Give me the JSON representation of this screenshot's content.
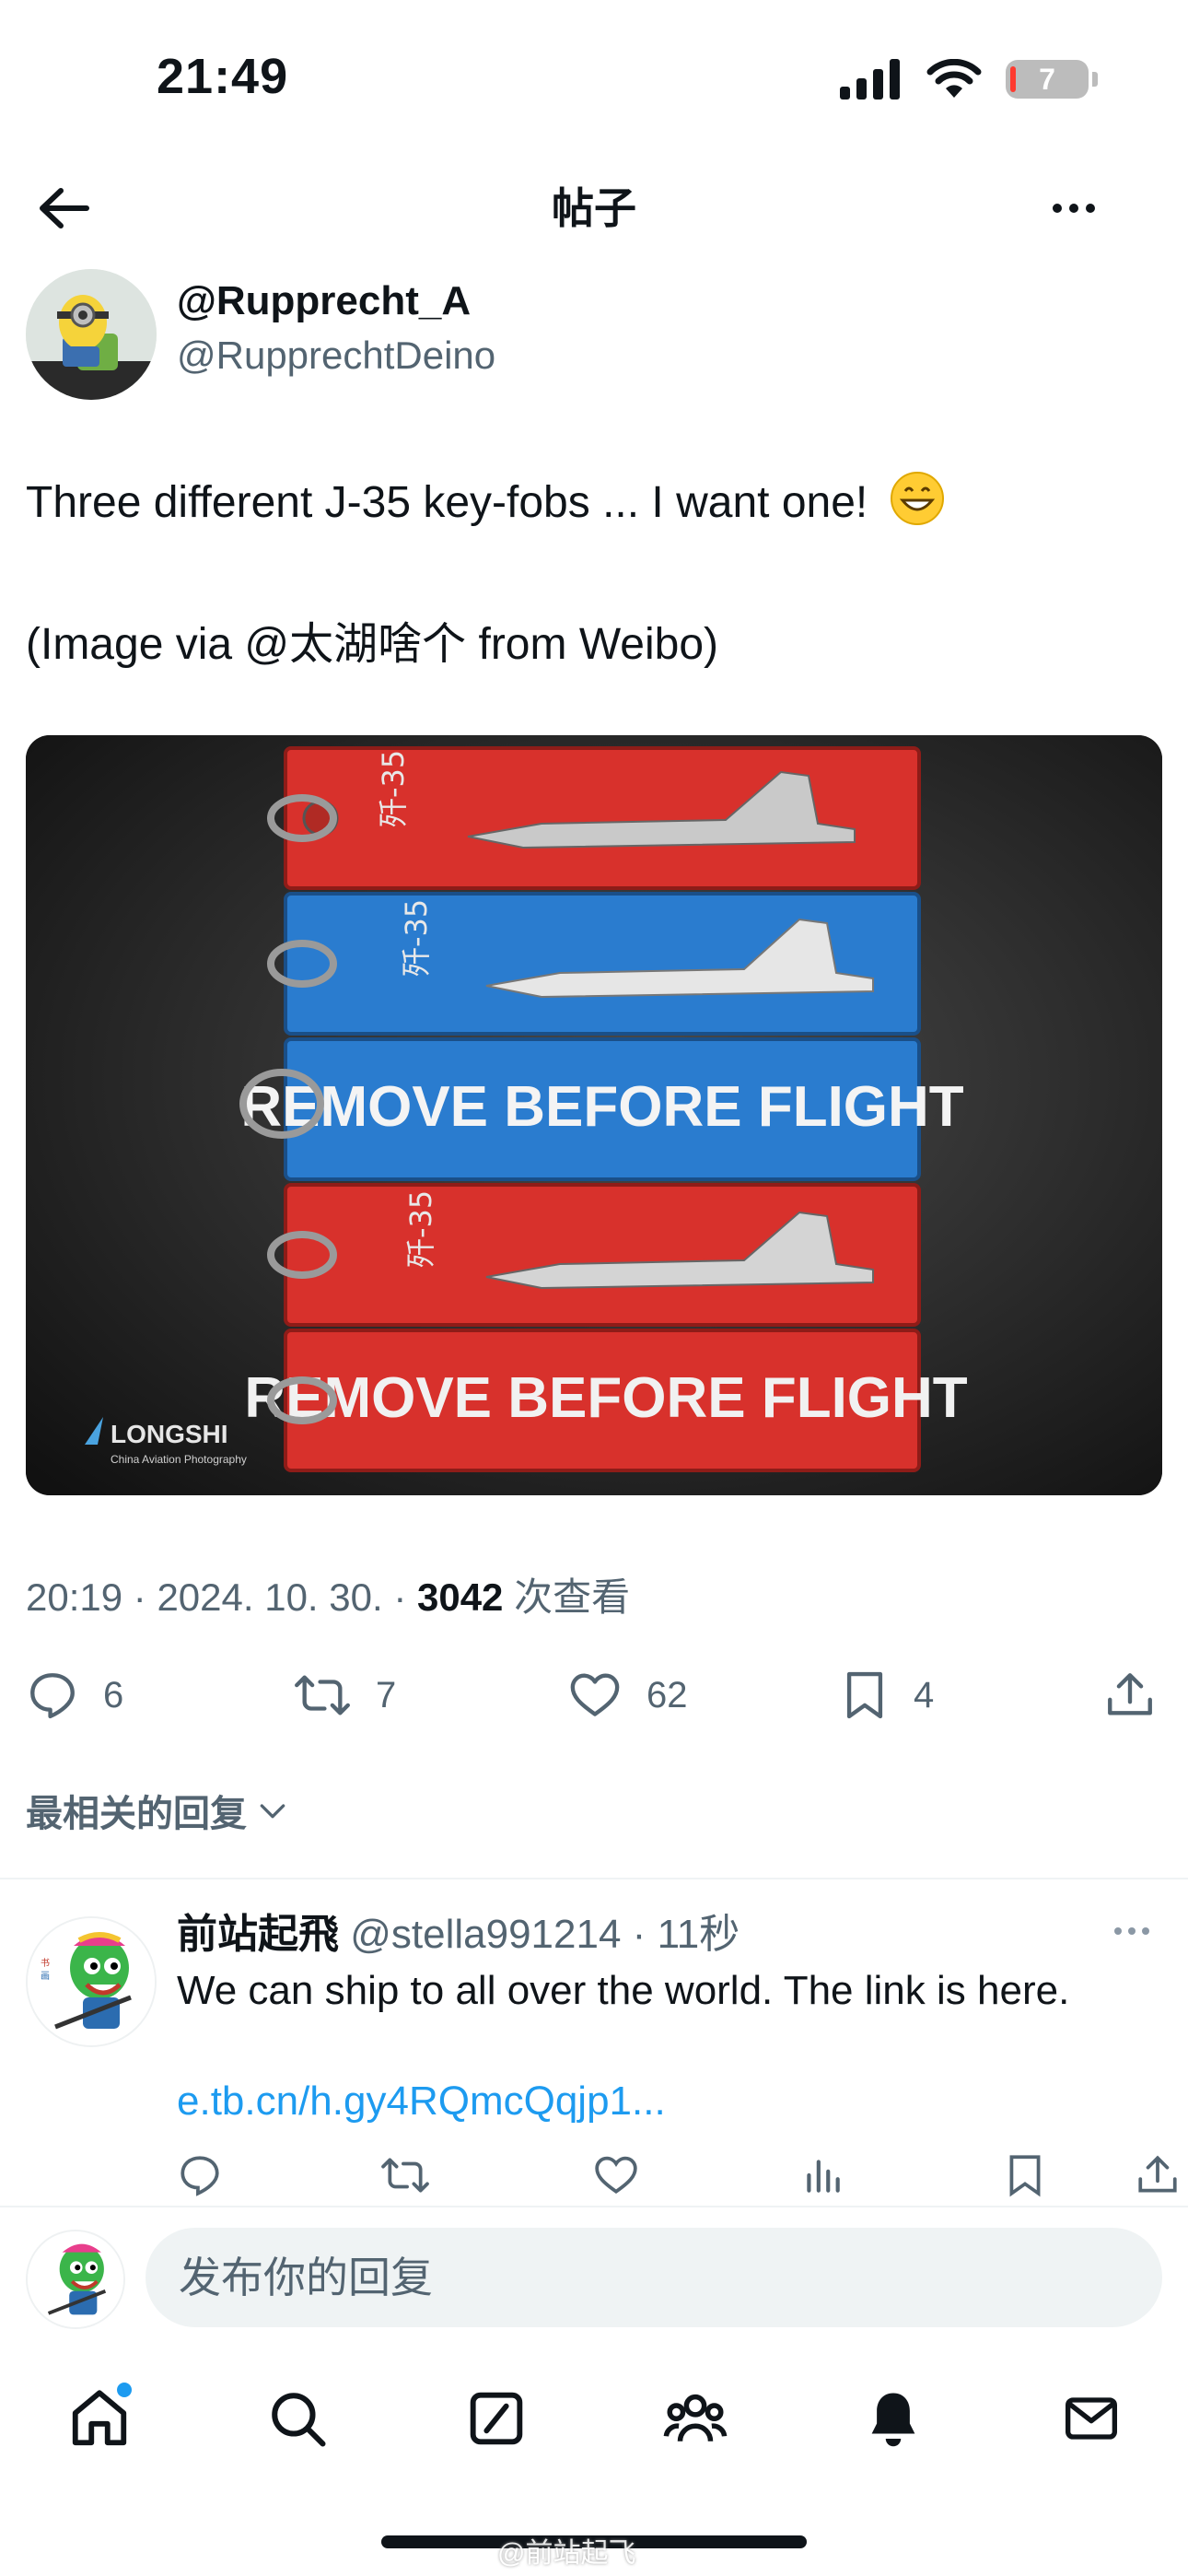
{
  "status_bar": {
    "time": "21:49",
    "battery": "7"
  },
  "header": {
    "title": "帖子"
  },
  "post": {
    "author_name": "@Rupprecht_A",
    "author_handle": "@RupprechtDeino",
    "text_line1": "Three different J-35 key-fobs ... I want one!",
    "text_line2": "(Image via @太湖啥个 from Weibo)",
    "image": {
      "tag_text_1": "REMOVE BEFORE FLIGHT",
      "tag_text_2": "REMOVE BEFORE FLIGHT",
      "tag_label": "歼-35",
      "watermark": "LONGSHI",
      "watermark_sub": "China Aviation Photography"
    },
    "time": "20:19",
    "date": "2024. 10. 30.",
    "views": "3042",
    "views_label": "次查看",
    "replies": "6",
    "reposts": "7",
    "likes": "62",
    "bookmarks": "4"
  },
  "sort": {
    "label": "最相关的回复"
  },
  "reply": {
    "name": "前站起飛",
    "handle": "@stella991214",
    "time": "11秒",
    "text": "We can ship to all over the world. The  link is here.",
    "link": "e.tb.cn/h.gy4RQmcQqjp1..."
  },
  "compose": {
    "placeholder": "发布你的回复"
  },
  "nav": [
    "home-icon",
    "search-icon",
    "grok-icon",
    "communities-icon",
    "notifications-icon",
    "messages-icon"
  ],
  "footer": {
    "watermark": "@前站起飞"
  },
  "colors": {
    "accent": "#1d9bf0",
    "text": "#0f1419",
    "muted": "#536471"
  }
}
